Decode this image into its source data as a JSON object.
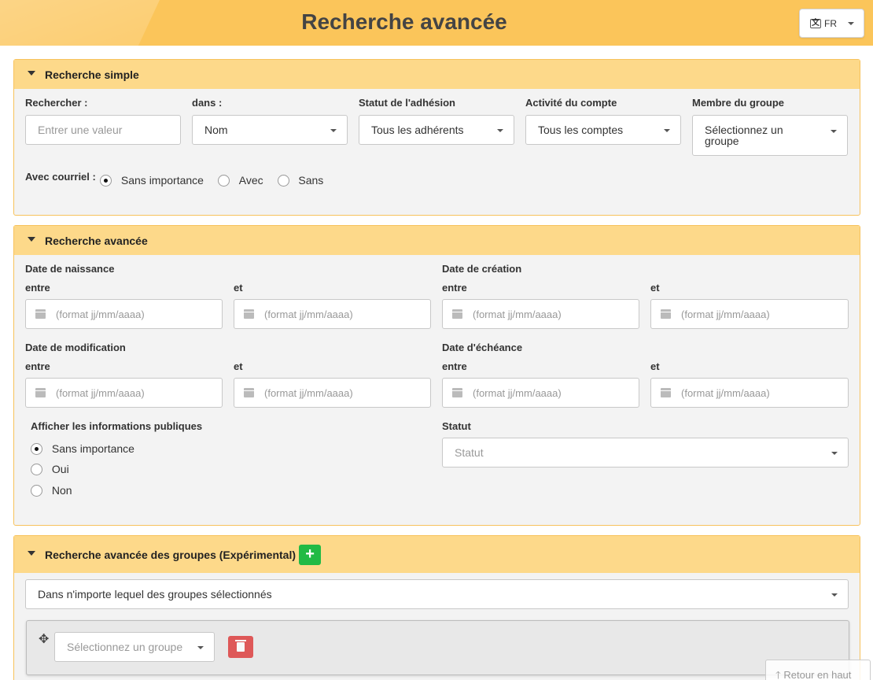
{
  "header": {
    "title": "Recherche avancée",
    "lang_label": "FR"
  },
  "simple": {
    "title": "Recherche simple",
    "search_label": "Rechercher :",
    "search_placeholder": "Entrer une valeur",
    "in_label": "dans :",
    "in_value": "Nom",
    "status_label": "Statut de l'adhésion",
    "status_value": "Tous les adhérents",
    "activity_label": "Activité du compte",
    "activity_value": "Tous les comptes",
    "group_label": "Membre du groupe",
    "group_value": "Sélectionnez un groupe",
    "email_label": "Avec courriel :",
    "email_options": [
      "Sans importance",
      "Avec",
      "Sans"
    ]
  },
  "advanced": {
    "title": "Recherche avancée",
    "birth_label": "Date de naissance",
    "creation_label": "Date de création",
    "modif_label": "Date de modification",
    "due_label": "Date d'échéance",
    "between": "entre",
    "and": "et",
    "date_placeholder": "(format jj/mm/aaaa)",
    "public_label": "Afficher les informations publiques",
    "public_options": [
      "Sans importance",
      "Oui",
      "Non"
    ],
    "statut_label": "Statut",
    "statut_placeholder": "Statut"
  },
  "groups": {
    "title": "Recherche avancée des groupes (Expérimental)",
    "add_icon": "+",
    "mode_value": "Dans n'importe lequel des groupes sélectionnés",
    "group_select_placeholder": "Sélectionnez un groupe"
  },
  "back_to_top": "Retour en haut"
}
